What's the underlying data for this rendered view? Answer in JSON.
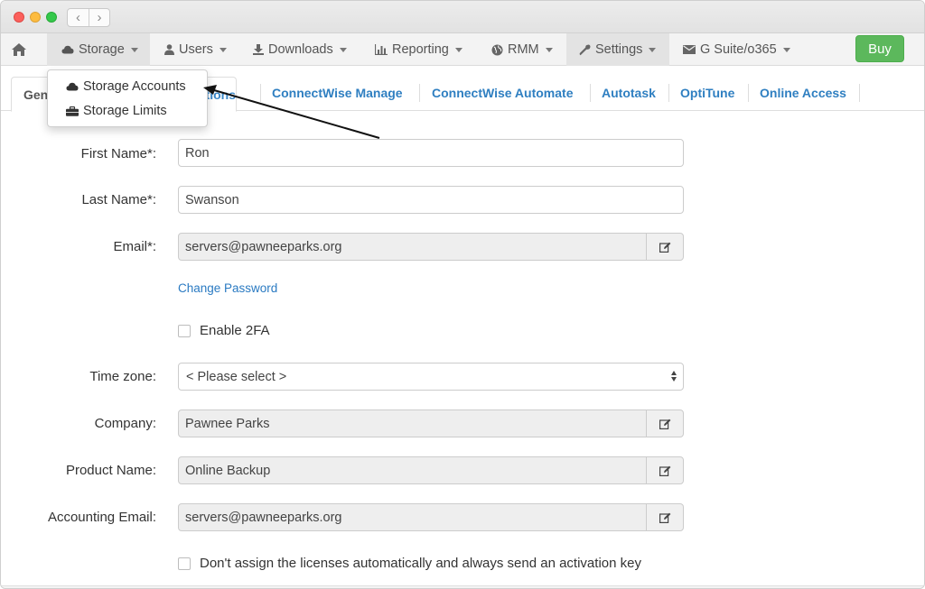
{
  "window": {
    "nav_back": "‹",
    "nav_forward": "›"
  },
  "menubar": {
    "home_icon": "home-icon",
    "items": [
      {
        "label": "Storage",
        "icon": "cloud-icon"
      },
      {
        "label": "Users",
        "icon": "user-icon"
      },
      {
        "label": "Downloads",
        "icon": "download-icon"
      },
      {
        "label": "Reporting",
        "icon": "bar-chart-icon"
      },
      {
        "label": "RMM",
        "icon": "globe-icon"
      },
      {
        "label": "Settings",
        "icon": "wrench-icon"
      },
      {
        "label": "G Suite/o365",
        "icon": "envelope-icon"
      }
    ],
    "buy_label": "Buy",
    "buy_color": "#5cb85c"
  },
  "dropdown": {
    "items": [
      {
        "label": "Storage Accounts",
        "icon": "cloud-icon"
      },
      {
        "label": "Storage Limits",
        "icon": "briefcase-icon"
      }
    ]
  },
  "tabs": {
    "general_left": "Gen",
    "general_right": "tions",
    "items": [
      "ConnectWise Manage",
      "ConnectWise Automate",
      "Autotask",
      "OptiTune",
      "Online Access"
    ],
    "link_color": "#2f7fc1"
  },
  "form": {
    "first_name_label": "First Name*:",
    "first_name_value": "Ron",
    "last_name_label": "Last Name*:",
    "last_name_value": "Swanson",
    "email_label": "Email*:",
    "email_value": "servers@pawneeparks.org",
    "change_password": "Change Password",
    "enable_2fa_label": "Enable 2FA",
    "timezone_label": "Time zone:",
    "timezone_value": "< Please select >",
    "company_label": "Company:",
    "company_value": "Pawnee Parks",
    "product_label": "Product Name:",
    "product_value": "Online Backup",
    "accounting_email_label": "Accounting Email:",
    "accounting_email_value": "servers@pawneeparks.org",
    "dont_assign_label": "Don't assign the licenses automatically and always send an activation key"
  }
}
